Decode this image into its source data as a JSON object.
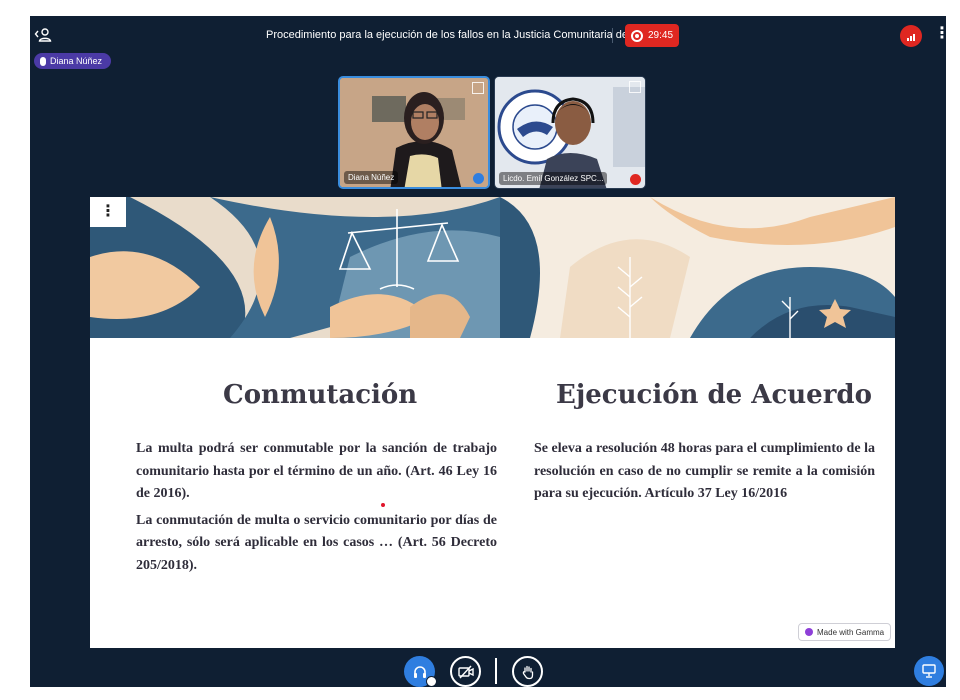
{
  "header": {
    "meeting_title": "Procedimiento para la ejecución de los fallos en la Justicia Comunitaria de Paz",
    "recording_time": "29:45",
    "recording_color": "#df2721"
  },
  "talking_indicator": {
    "name": "Diana Núñez",
    "color": "#4b3aa6"
  },
  "videos": [
    {
      "name": "Diana Núñez",
      "status_icon": "mic-on-icon",
      "active_speaker": true
    },
    {
      "name": "Licdo. Emil González SPC...",
      "status_icon": "mic-muted-icon",
      "active_speaker": false
    }
  ],
  "slide": {
    "left_heading": "Conmutación",
    "left_paragraphs": [
      "La multa podrá ser conmutable por la sanción de trabajo comunitario hasta por el término de un año. (Art. 46 Ley 16 de 2016).",
      "La conmutación de multa o servicio comunitario por días de arresto, sólo será aplicable en los casos … (Art. 56 Decreto 205/2018)."
    ],
    "right_heading": "Ejecución de Acuerdo",
    "right_paragraphs": [
      "Se eleva a resolución 48 horas para el cumplimiento de la resolución  en caso de no cumplir se remite a la comisión para su ejecución. Artículo 37 Ley 16/2016"
    ],
    "badge": "Made with Gamma"
  },
  "controls": {
    "audio": "headphones-icon",
    "camera": "camera-off-icon",
    "reaction": "hand-icon",
    "presentation": "presentation-icon",
    "accent": "#2f7ee0"
  }
}
